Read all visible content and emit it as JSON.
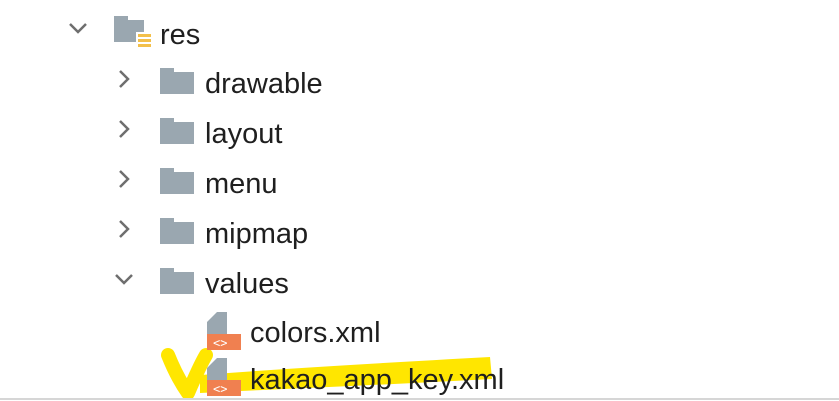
{
  "tree": {
    "root": {
      "label": "res",
      "expanded": true
    },
    "folders": [
      {
        "label": "drawable",
        "expanded": false
      },
      {
        "label": "layout",
        "expanded": false
      },
      {
        "label": "menu",
        "expanded": false
      },
      {
        "label": "mipmap",
        "expanded": false
      },
      {
        "label": "values",
        "expanded": true
      }
    ],
    "files": [
      {
        "label": "colors.xml"
      },
      {
        "label": "kakao_app_key.xml"
      }
    ]
  },
  "colors": {
    "arrow": "#6e6e6e",
    "folder": "#9aa7b0",
    "xml_badge": "#f08050",
    "highlight": "#ffe600"
  },
  "icons": {
    "expand": "chevron-down-icon",
    "collapse": "chevron-right-icon",
    "folder": "folder-icon",
    "resource_folder": "resource-folder-icon",
    "xml": "xml-file-icon"
  }
}
